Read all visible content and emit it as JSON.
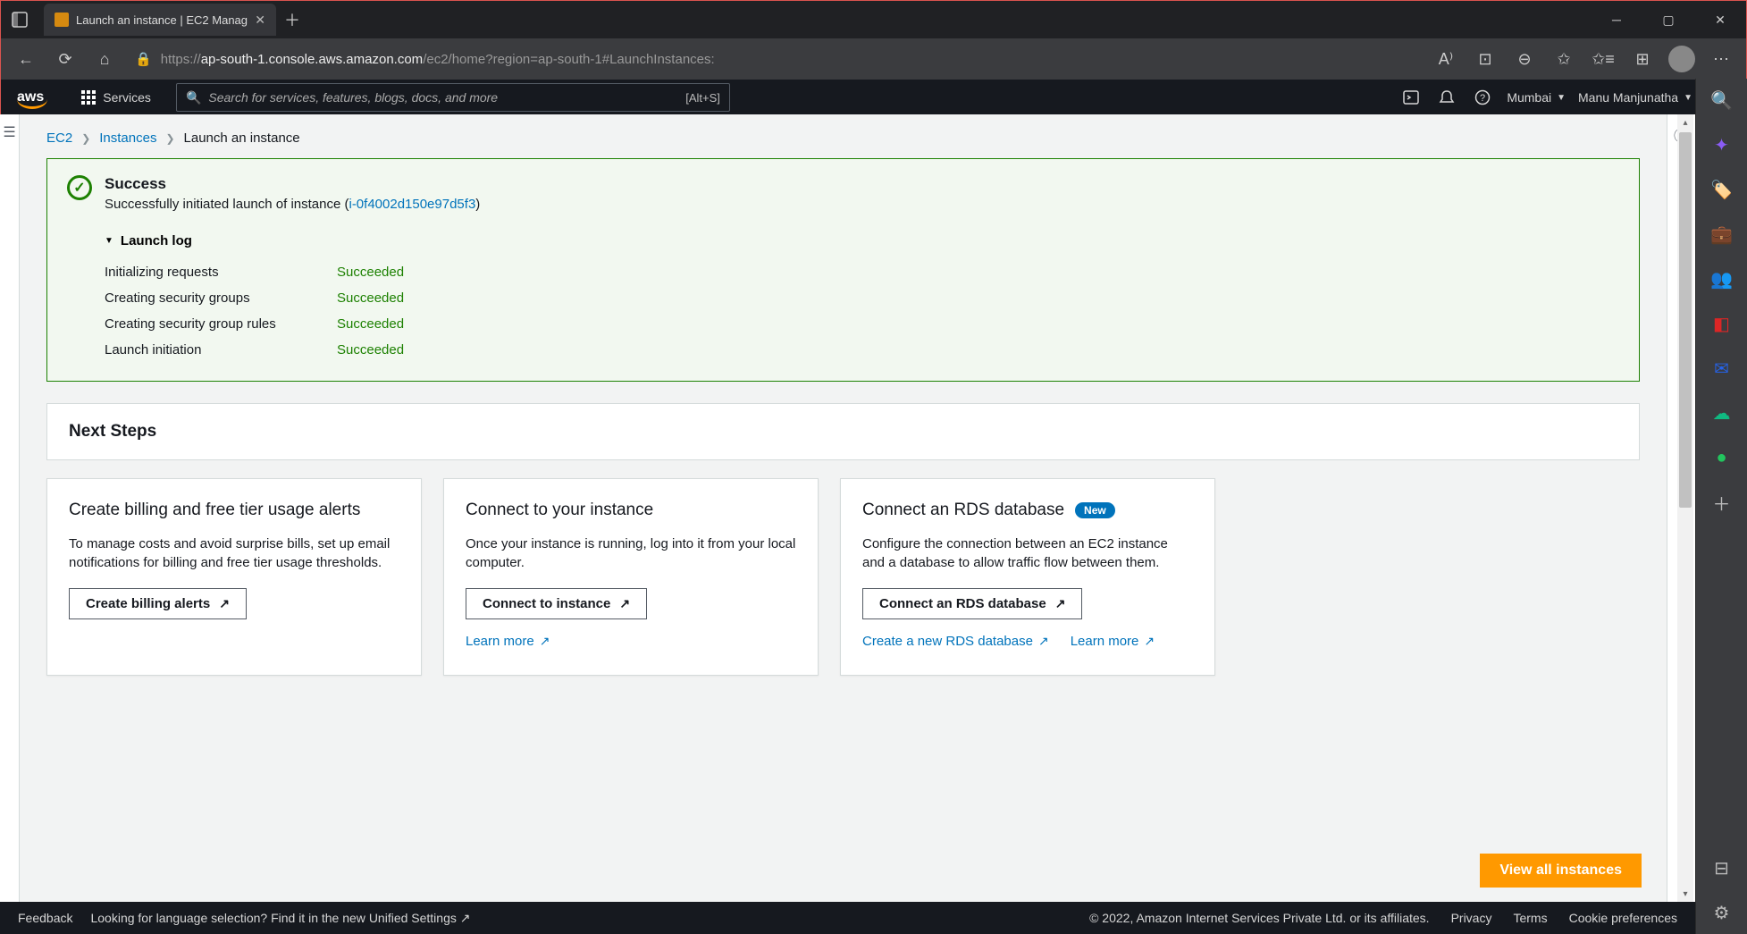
{
  "browser": {
    "tab_title": "Launch an instance | EC2 Manag",
    "url_bold": "ap-south-1.console.aws.amazon.com",
    "url_rest": "/ec2/home?region=ap-south-1#LaunchInstances:",
    "url_prefix": "https://"
  },
  "aws_nav": {
    "services_label": "Services",
    "search_placeholder": "Search for services, features, blogs, docs, and more",
    "search_kbd": "[Alt+S]",
    "region": "Mumbai",
    "user": "Manu Manjunatha"
  },
  "breadcrumb": {
    "ec2": "EC2",
    "instances": "Instances",
    "current": "Launch an instance"
  },
  "success": {
    "title": "Success",
    "subtitle_pre": "Successfully initiated launch of instance (",
    "instance_link": "i-0f4002d150e97d5f3",
    "subtitle_post": ")",
    "log_heading": "Launch log",
    "log": [
      {
        "k": "Initializing requests",
        "v": "Succeeded"
      },
      {
        "k": "Creating security groups",
        "v": "Succeeded"
      },
      {
        "k": "Creating security group rules",
        "v": "Succeeded"
      },
      {
        "k": "Launch initiation",
        "v": "Succeeded"
      }
    ]
  },
  "next_steps": {
    "heading": "Next Steps",
    "tiles": [
      {
        "id": "billing",
        "title": "Create billing and free tier usage alerts",
        "desc": "To manage costs and avoid surprise bills, set up email notifications for billing and free tier usage thresholds.",
        "button": "Create billing alerts"
      },
      {
        "id": "connect",
        "title": "Connect to your instance",
        "desc": "Once your instance is running, log into it from your local computer.",
        "button": "Connect to instance",
        "learn_more": "Learn more"
      },
      {
        "id": "rds",
        "title": "Connect an RDS database",
        "badge": "New",
        "desc": "Configure the connection between an EC2 instance and a database to allow traffic flow between them.",
        "button": "Connect an RDS database",
        "links": [
          "Create a new RDS database",
          "Learn more"
        ]
      }
    ],
    "view_all": "View all instances"
  },
  "footer": {
    "feedback": "Feedback",
    "lang_pre": "Looking for language selection? Find it in the new ",
    "lang_link": "Unified Settings",
    "copyright": "© 2022, Amazon Internet Services Private Ltd. or its affiliates.",
    "privacy": "Privacy",
    "terms": "Terms",
    "cookies": "Cookie preferences"
  }
}
